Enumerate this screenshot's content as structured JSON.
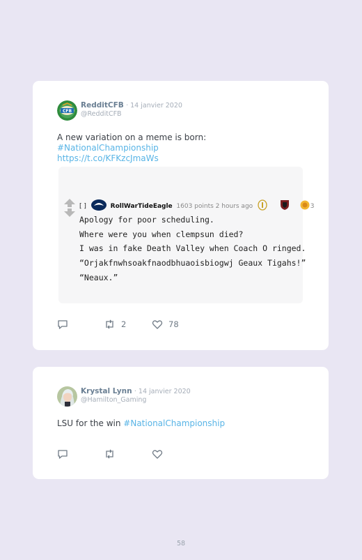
{
  "tweets": [
    {
      "name": "RedditCFB",
      "date": "· 14 janvier 2020",
      "handle": "@RedditCFB",
      "text": "A new variation on a meme is born: ",
      "hashtag": "#NationalChampionship",
      "url": "https://t.co/KFKzcJmaWs",
      "avatar_label": "CFB",
      "embed": {
        "bracket": "[ ]",
        "user": "RollWarTideEagle",
        "meta": "1603 points 2 hours ago",
        "award_count": "3",
        "lines": [
          "Apology for poor scheduling.",
          "Where were you when clempsun died?",
          "I was in fake Death Valley when Coach O ringed.",
          "“Orjakfnwhsoakfnaodbhuaoisbiogwj Geaux Tigahs!”",
          "“Neaux.”"
        ]
      },
      "retweets": "2",
      "likes": "78"
    },
    {
      "name": "Krystal Lynn",
      "date": "· 14 janvier 2020",
      "handle": "@Hamilton_Gaming",
      "text": "LSU for the win ",
      "hashtag": "#NationalChampionship"
    }
  ],
  "page_number": "58",
  "colors": {
    "background": "#e9e6f3",
    "link": "#58b4e6",
    "card": "#ffffff"
  }
}
